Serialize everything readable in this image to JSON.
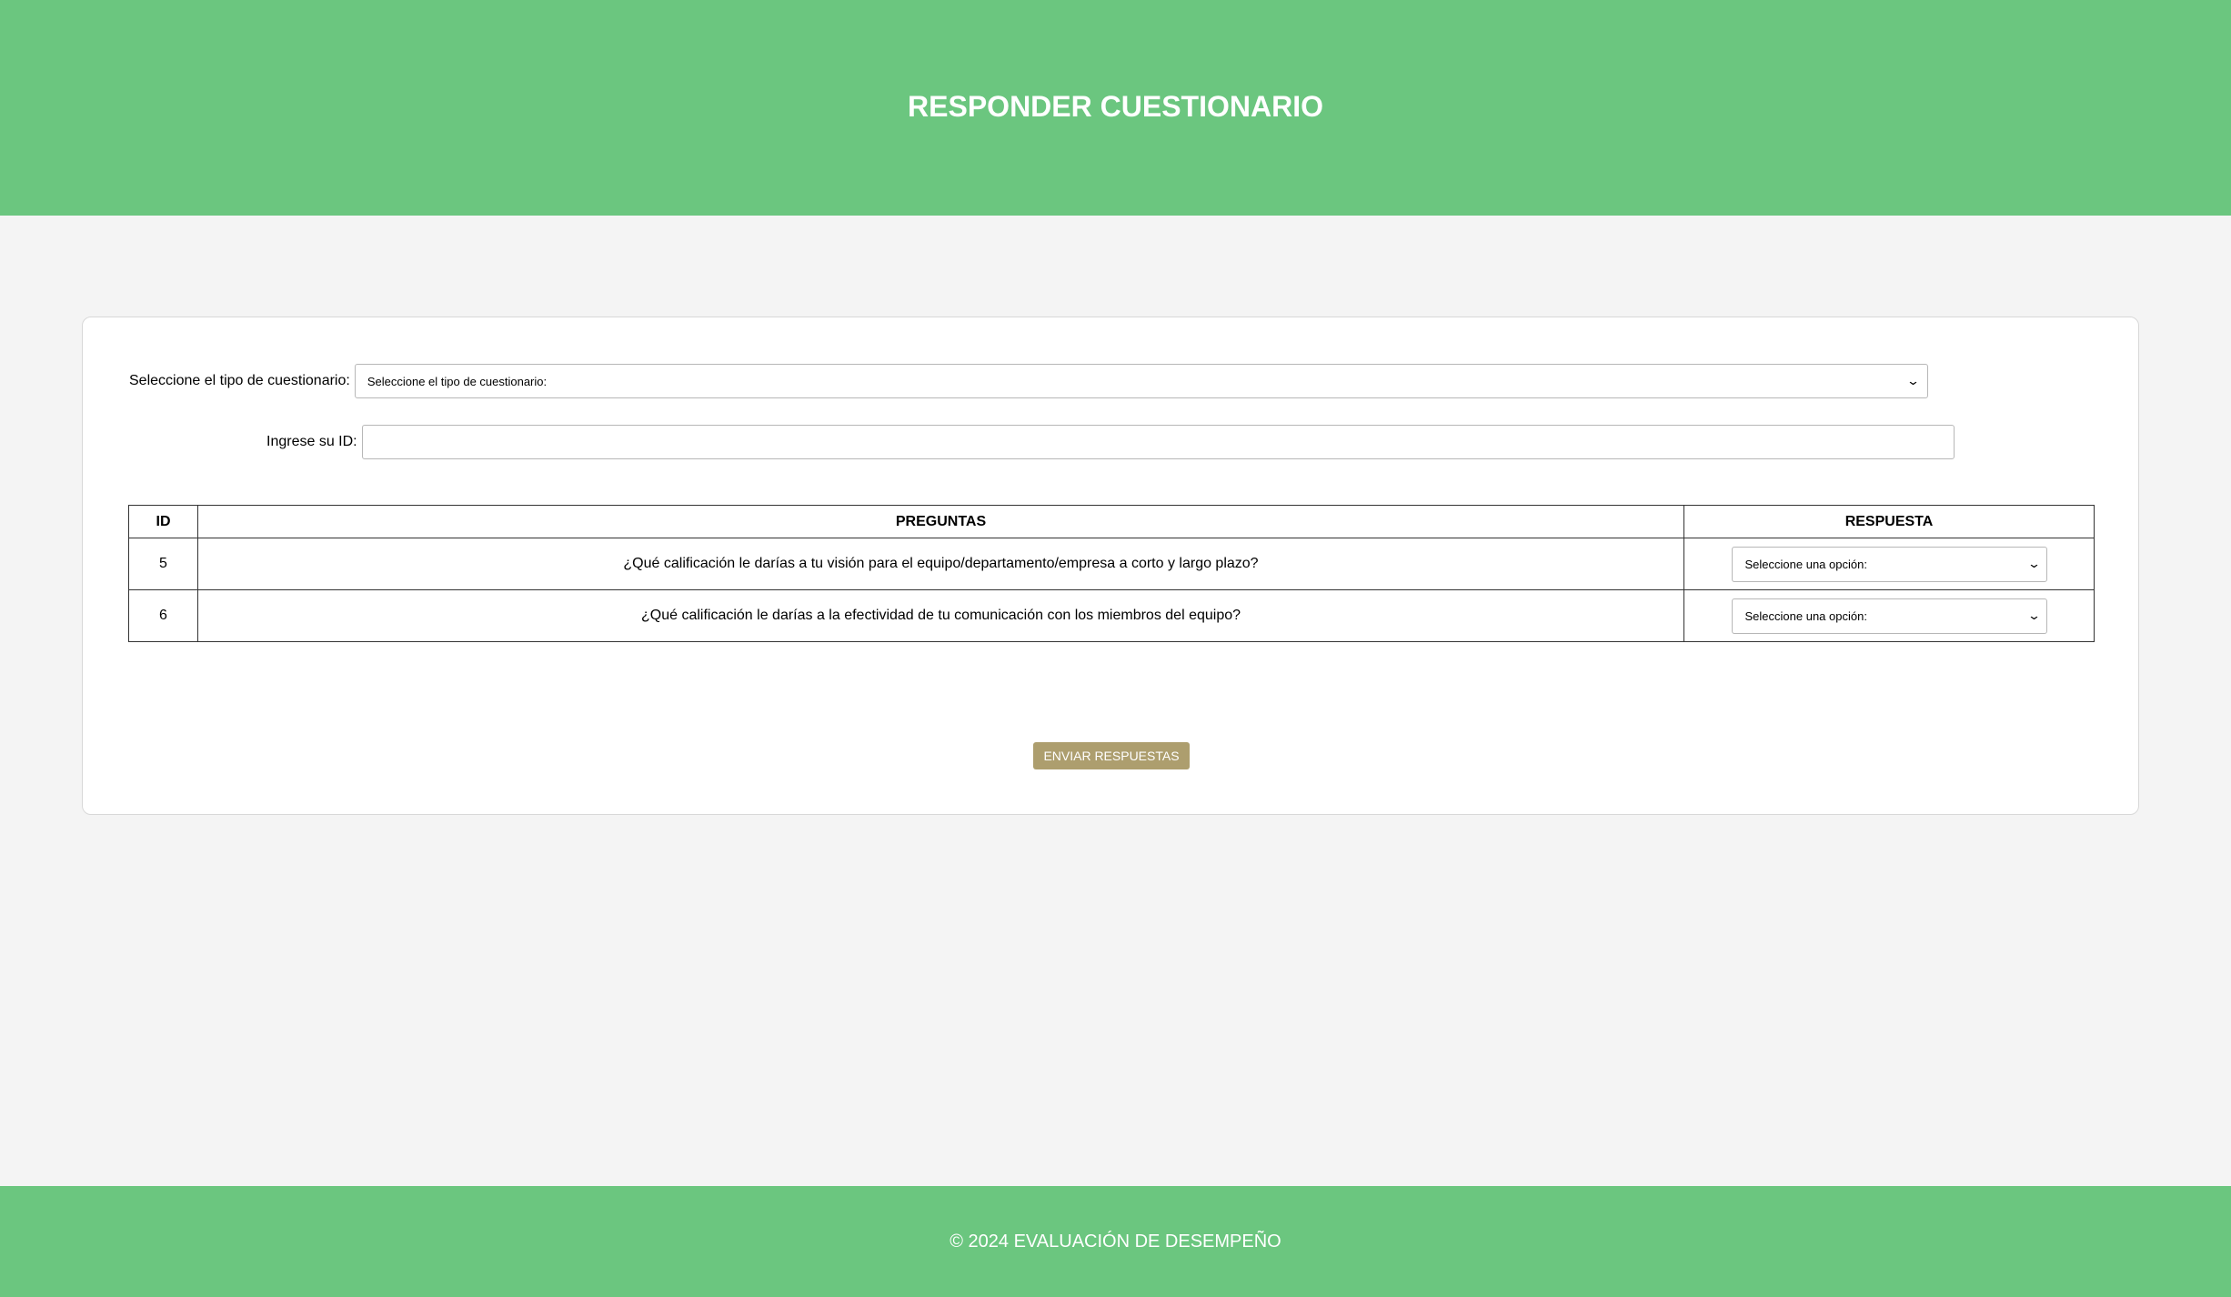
{
  "header": {
    "title": "RESPONDER CUESTIONARIO"
  },
  "form": {
    "type_label": "Seleccione el tipo de cuestionario:",
    "type_select_value": "Seleccione el tipo de cuestionario:",
    "id_label": "Ingrese su ID:",
    "id_value": ""
  },
  "table": {
    "headers": [
      "ID",
      "PREGUNTAS",
      "RESPUESTA"
    ],
    "rows": [
      {
        "id": "5",
        "question": "¿Qué calificación le darías a tu visión para el equipo/departamento/empresa a corto y largo plazo?",
        "answer": "Seleccione una opción:"
      },
      {
        "id": "6",
        "question": "¿Qué calificación le darías a la efectividad de tu comunicación con los miembros del equipo?",
        "answer": "Seleccione una opción:"
      }
    ]
  },
  "actions": {
    "submit_label": "ENVIAR RESPUESTAS"
  },
  "footer": {
    "text": "© 2024 EVALUACIÓN DE DESEMPEÑO"
  },
  "colors": {
    "header_bg": "#6bc67f",
    "button_bg": "#ad9e6e",
    "page_bg": "#f4f4f4"
  }
}
